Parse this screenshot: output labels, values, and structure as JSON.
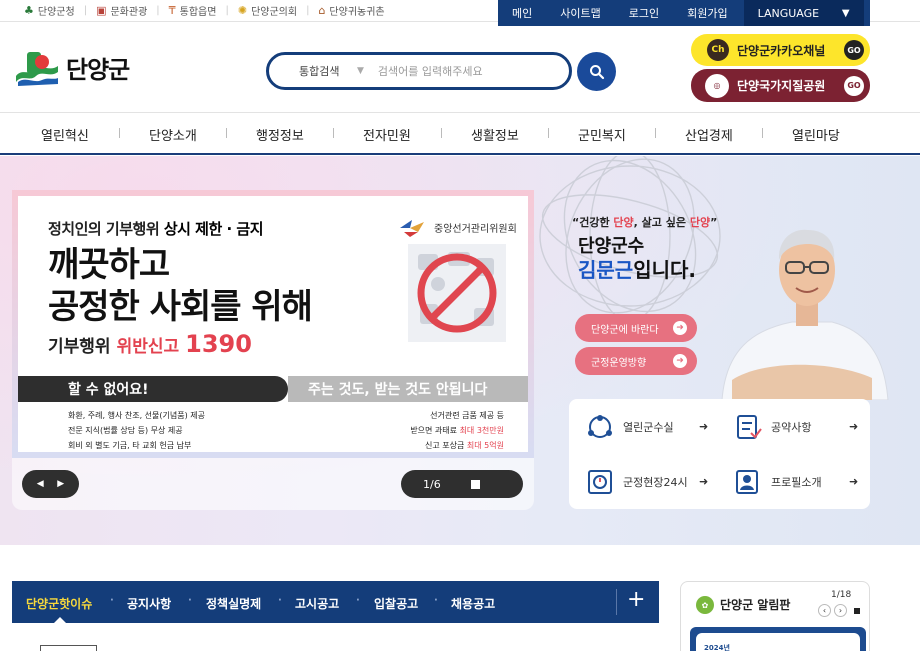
{
  "top_links": [
    {
      "label": "단양군청",
      "icon": "building-icon"
    },
    {
      "label": "문화관광",
      "icon": "camera-icon"
    },
    {
      "label": "통합읍면",
      "icon": "signpost-icon"
    },
    {
      "label": "단양군의회",
      "icon": "emblem-icon"
    },
    {
      "label": "단양귀농귀촌",
      "icon": "house-icon"
    }
  ],
  "top_nav": {
    "home": "메인",
    "sitemap": "사이트맵",
    "login": "로그인",
    "join": "회원가입",
    "language": "LANGUAGE"
  },
  "logo": {
    "name": "단양군"
  },
  "search": {
    "category": "통합검색",
    "placeholder": "검색어를 입력해주세요"
  },
  "shortcuts": {
    "kakao": {
      "badge": "Ch",
      "label": "단양군카카오채널",
      "go": "GO"
    },
    "park": {
      "label": "단양국가지질공원",
      "go": "GO"
    }
  },
  "gnb": [
    "열린혁신",
    "단양소개",
    "행정정보",
    "전자민원",
    "생활정보",
    "군민복지",
    "산업경제",
    "열린마당"
  ],
  "banner": {
    "subtitle_prefix": "정치인의 기부행위 ",
    "subtitle_strong": "상시 제한 · 금지",
    "org": "중앙선거관리위원회",
    "headline_1": "깨끗하고",
    "headline_2": "공정한 사회를 위해",
    "line_prefix": "기부행위",
    "line_red": "위반신고",
    "line_number": "1390",
    "bar_left": "할 수 없어요!",
    "bar_right": "주는 것도, 받는 것도 안됩니다",
    "left_list": [
      "화환, 주례, 행사 찬조, 선물(기념품) 제공",
      "전문 지식(법률 상담 등) 무상 제공",
      "회비 외 별도 기금, 타 교회 헌금 납부"
    ],
    "right_list": [
      {
        "text": "선거관련 금품 제공 등",
        "red": ""
      },
      {
        "text": "받으면 과태료 ",
        "red": "최대 3천만원"
      },
      {
        "text": "신고 포상금 ",
        "red": "최대 5억원"
      }
    ],
    "pager": "1/6"
  },
  "governor": {
    "quote_1": "“건강한 ",
    "quote_red_1": "단양",
    "quote_2": ", 살고 싶은 ",
    "quote_red_2": "단양",
    "quote_3": "”",
    "title": "단양군수",
    "name": "김문근",
    "suffix": "입니다.",
    "btn_wish": "단양군에 바란다",
    "btn_policy": "군정운영방향"
  },
  "quick_links": [
    {
      "label": "열린군수실",
      "icon": "people-circle-icon"
    },
    {
      "label": "공약사항",
      "icon": "checklist-icon"
    },
    {
      "label": "군정현장24시",
      "icon": "clock-icon"
    },
    {
      "label": "프로필소개",
      "icon": "profile-icon"
    }
  ],
  "notice_tabs": [
    "단양군핫이슈",
    "공지사항",
    "정책실명제",
    "고시공고",
    "입찰공고",
    "채용공고"
  ],
  "notice_more": "+",
  "board": {
    "title": "단양군 알림판",
    "count": "1/18",
    "card_text": "2024년"
  }
}
